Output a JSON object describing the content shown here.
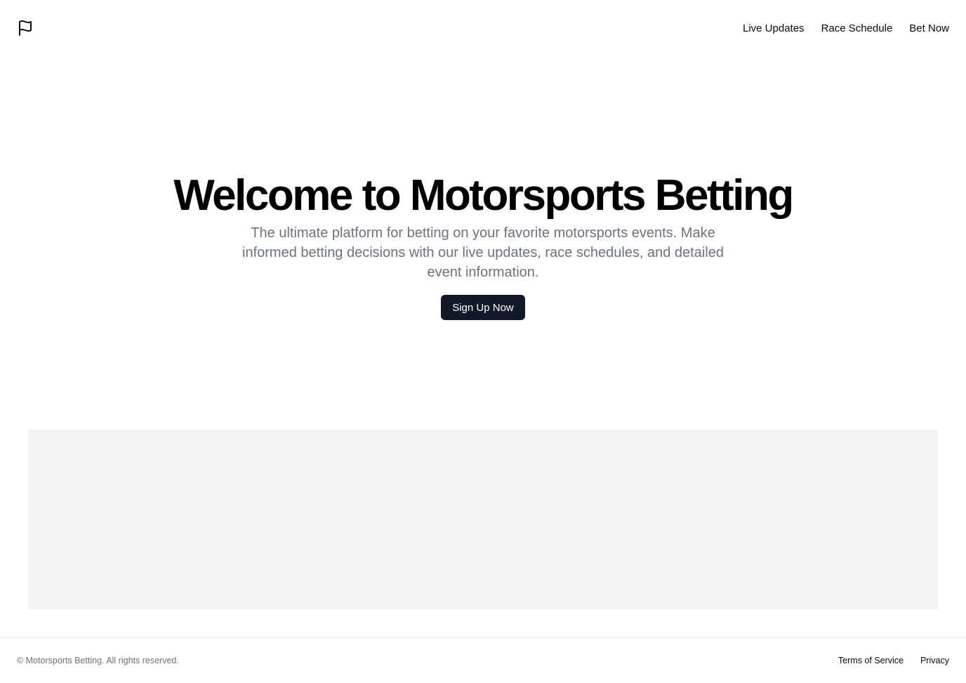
{
  "header": {
    "logo_icon": "flag-icon",
    "nav": [
      {
        "label": "Live Updates"
      },
      {
        "label": "Race Schedule"
      },
      {
        "label": "Bet Now"
      }
    ]
  },
  "hero": {
    "title": "Welcome to Motorsports Betting",
    "subtitle": "The ultimate platform for betting on your favorite motorsports events. Make informed betting decisions with our live updates, race schedules, and detailed event information.",
    "cta_label": "Sign Up Now"
  },
  "footer": {
    "copyright": "© Motorsports Betting. All rights reserved.",
    "links": [
      {
        "label": "Terms of Service"
      },
      {
        "label": "Privacy"
      }
    ]
  },
  "colors": {
    "primary_button": "#111827",
    "muted_text": "#6b7280",
    "panel_background": "#f2f3f5"
  }
}
